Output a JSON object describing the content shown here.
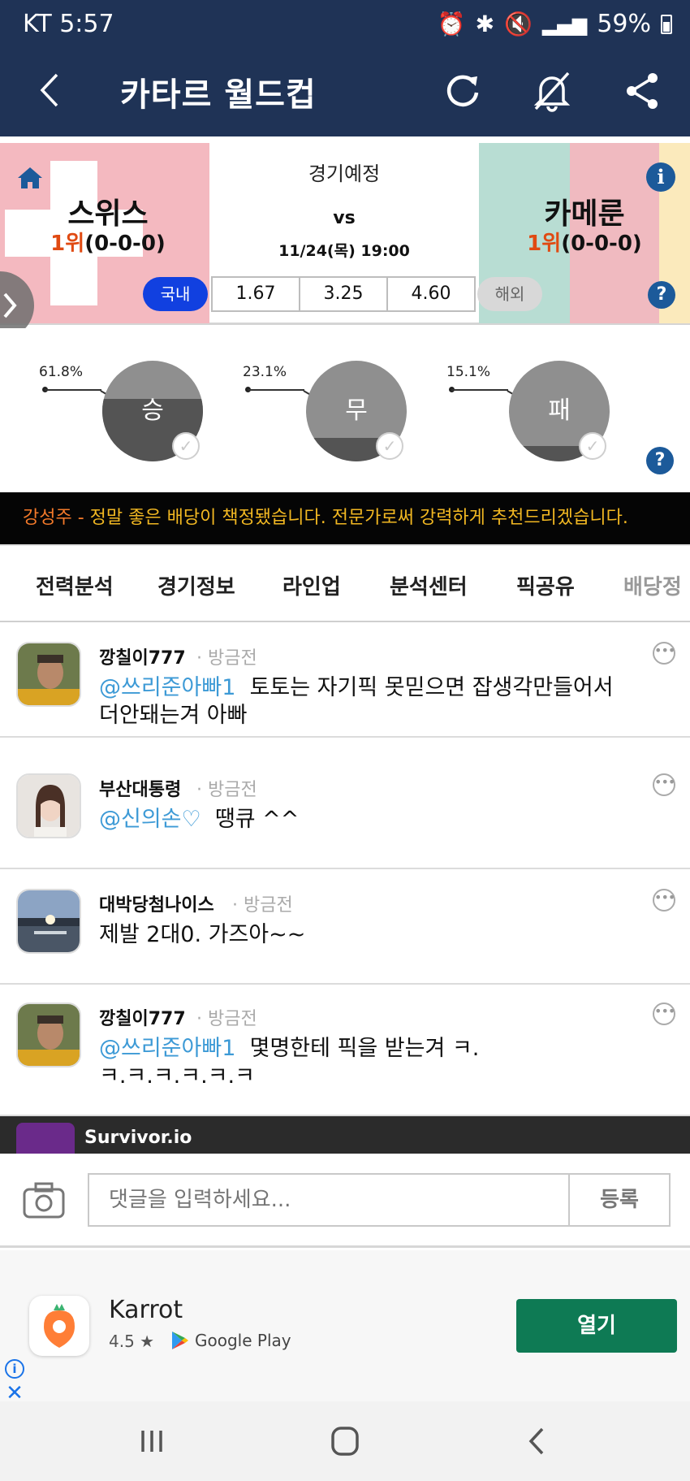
{
  "status_bar": {
    "carrier_time": "KT 5:57",
    "battery": "59%"
  },
  "header": {
    "title": "카타르 월드컵"
  },
  "match": {
    "status": "경기예정",
    "vs": "vs",
    "datetime": "11/24(목) 19:00",
    "home": {
      "name": "스위스",
      "rank": "1위",
      "record": "(0-0-0)"
    },
    "away": {
      "name": "카메룬",
      "rank": "1위",
      "record": "(0-0-0)"
    },
    "odds_domestic_label": "국내",
    "odds_overseas_label": "해외",
    "odds": [
      "1.67",
      "3.25",
      "4.60"
    ]
  },
  "prediction": {
    "items": [
      {
        "label": "승",
        "percent": "61.8%",
        "fraction": 0.618
      },
      {
        "label": "무",
        "percent": "23.1%",
        "fraction": 0.231
      },
      {
        "label": "패",
        "percent": "15.1%",
        "fraction": 0.151
      }
    ]
  },
  "ticker": {
    "author": "강성주",
    "dash": " - ",
    "message": "정말 좋은 배당이 책정됐습니다. 전문가로써 강력하게 추천드리겠습니다."
  },
  "tabs": [
    "전력분석",
    "경기정보",
    "라인업",
    "분석센터",
    "픽공유",
    "배당정"
  ],
  "comments": [
    {
      "user": "깡칠이777",
      "time": "방금전",
      "mention": "@쓰리준아빠1",
      "text": "토토는 자기픽 못믿으면 잡생각만들어서 더안돼는겨 아빠"
    },
    {
      "user": "부산대통령",
      "time": "방금전",
      "mention": "@신의손♡",
      "text": "땡큐 ^^"
    },
    {
      "user": "대박당첨나이스",
      "time": "방금전",
      "mention": "",
      "text": "제발 2대0. 가즈아~~"
    },
    {
      "user": "깡칠이777",
      "time": "방금전",
      "mention": "@쓰리준아빠1",
      "text": "몇명한테 픽을 받는겨 ㅋ.ㅋ.ㅋ.ㅋ.ㅋ.ㅋ.ㅋ"
    }
  ],
  "banner": {
    "name": "Survivor.io"
  },
  "comment_input": {
    "placeholder": "댓글을 입력하세요...",
    "submit_label": "등록"
  },
  "ad": {
    "name": "Karrot",
    "rating": "4.5 ★",
    "store": "Google Play",
    "open_label": "열기"
  },
  "colors": {
    "header_bg": "#1f3356",
    "domestic_tag": "#1140e0",
    "mention": "#3d9ad6",
    "ticker_text": "#f2b822",
    "ad_button": "#0e7a54"
  }
}
